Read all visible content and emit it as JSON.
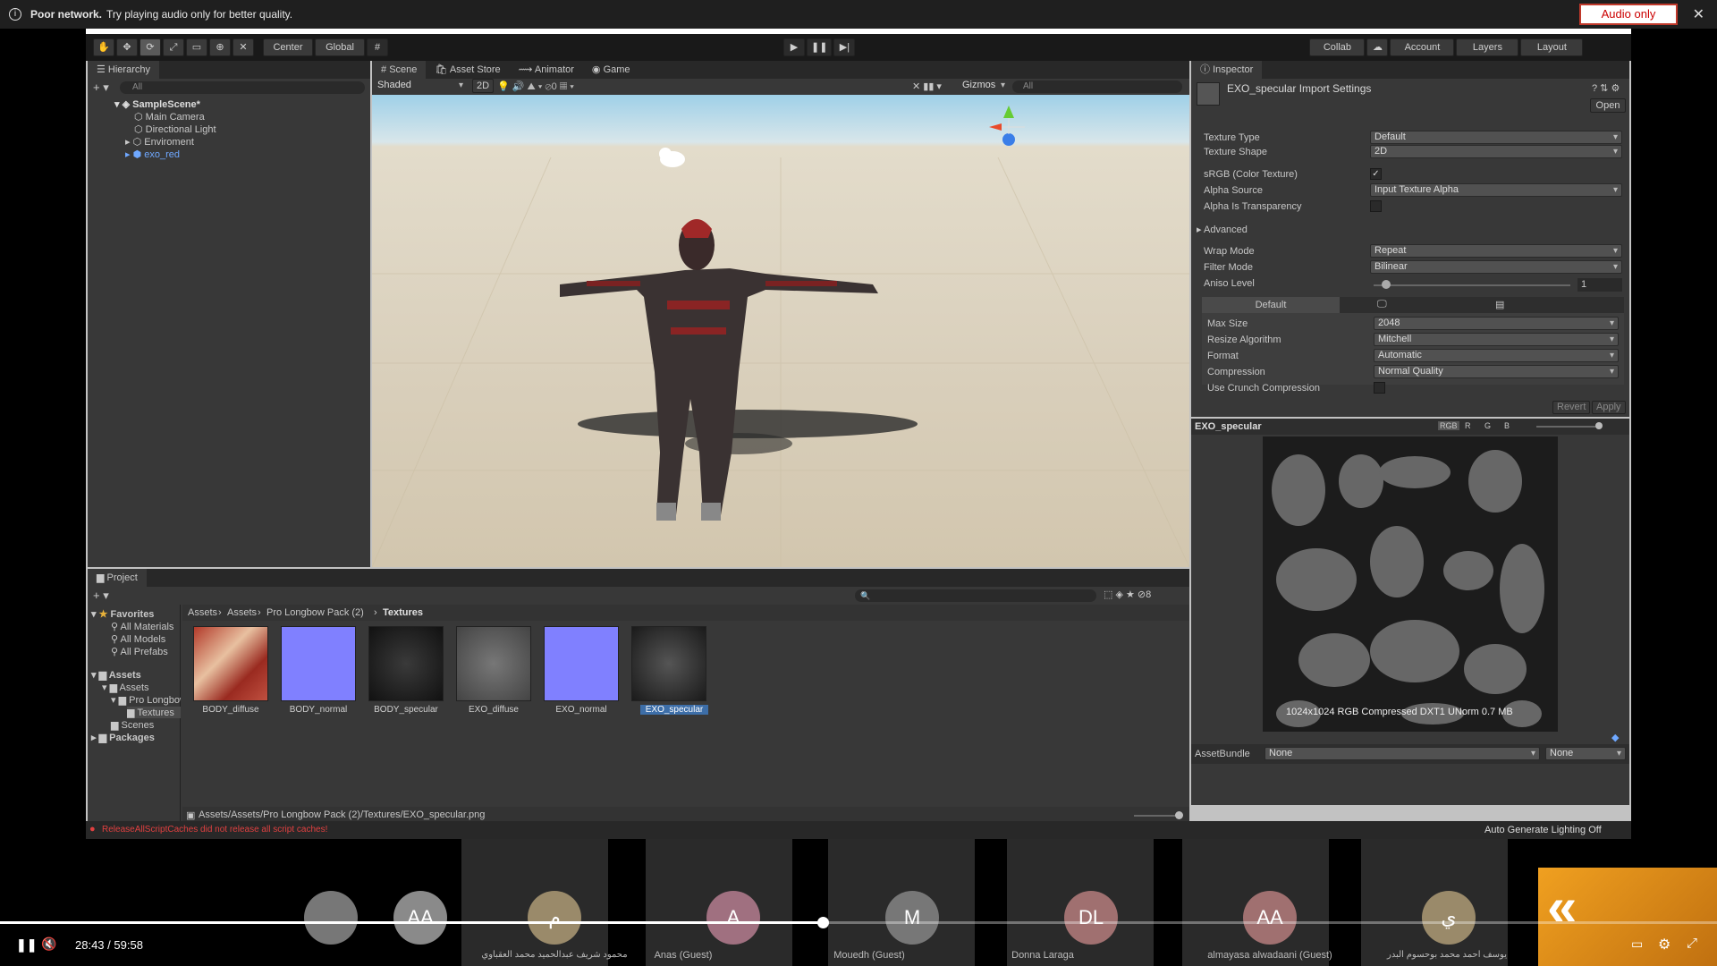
{
  "banner": {
    "title": "Poor network.",
    "text": "Try playing audio only for better quality.",
    "button": "Audio only",
    "close": "✕"
  },
  "toolbar": {
    "center": "Center",
    "global": "Global",
    "collab": "Collab",
    "account": "Account",
    "layers": "Layers",
    "layout": "Layout"
  },
  "hierarchy": {
    "tab": "Hierarchy",
    "search": "All",
    "scene": "SampleScene*",
    "items": [
      "Main Camera",
      "Directional Light",
      "Enviroment",
      "exo_red"
    ]
  },
  "scene": {
    "tabs": [
      "Scene",
      "Asset Store",
      "Animator",
      "Game"
    ],
    "shading": "Shaded",
    "mode2d": "2D",
    "gizmos": "Gizmos",
    "search": "All",
    "count": "0"
  },
  "inspector": {
    "tab": "Inspector",
    "title": "EXO_specular Import Settings",
    "open": "Open",
    "fields": [
      {
        "label": "Texture Type",
        "value": "Default"
      },
      {
        "label": "Texture Shape",
        "value": "2D"
      }
    ],
    "srgb": "sRGB (Color Texture)",
    "alpha_source_label": "Alpha Source",
    "alpha_source": "Input Texture Alpha",
    "alpha_transparency": "Alpha Is Transparency",
    "advanced": "Advanced",
    "wrap_label": "Wrap Mode",
    "wrap": "Repeat",
    "filter_label": "Filter Mode",
    "filter": "Bilinear",
    "aniso_label": "Aniso Level",
    "aniso": "1",
    "platform_default": "Default",
    "platform": [
      {
        "label": "Max Size",
        "value": "2048"
      },
      {
        "label": "Resize Algorithm",
        "value": "Mitchell"
      },
      {
        "label": "Format",
        "value": "Automatic"
      },
      {
        "label": "Compression",
        "value": "Normal Quality"
      }
    ],
    "crunch": "Use Crunch Compression",
    "revert": "Revert",
    "apply": "Apply"
  },
  "preview": {
    "title": "EXO_specular",
    "channels": [
      "RGB",
      "R",
      "G",
      "B"
    ],
    "info": "1024x1024  RGB Compressed DXT1 UNorm   0.7 MB",
    "assetbundle_label": "AssetBundle",
    "bundle": "None",
    "variant": "None"
  },
  "project": {
    "tab": "Project",
    "favorites": "Favorites",
    "fav_items": [
      "All Materials",
      "All Models",
      "All Prefabs"
    ],
    "assets_root": "Assets",
    "tree": [
      "Assets",
      "Pro Longbow Pack (2)",
      "Textures",
      "Scenes"
    ],
    "packages": "Packages",
    "breadcrumb": [
      "Assets",
      "Assets",
      "Pro Longbow Pack (2)",
      "Textures"
    ],
    "thumbs": [
      "BODY_diffuse",
      "BODY_normal",
      "BODY_specular",
      "EXO_diffuse",
      "EXO_normal",
      "EXO_specular"
    ],
    "path": "Assets/Assets/Pro Longbow Pack (2)/Textures/EXO_specular.png",
    "count": "8"
  },
  "console": {
    "error": "ReleaseAllScriptCaches did not release all script caches!",
    "lighting": "Auto Generate Lighting Off"
  },
  "video": {
    "time": "28:43",
    "sep": "/",
    "duration": "59:58",
    "progress": 0.479
  },
  "participants": [
    {
      "initials": "",
      "name": ""
    },
    {
      "initials": "AA",
      "name": ""
    },
    {
      "initials": "م",
      "name": "محمود شريف عبدالحميد محمد العقباوي"
    },
    {
      "initials": "A",
      "name": "Anas (Guest)"
    },
    {
      "initials": "M",
      "name": "Mouedh (Guest)"
    },
    {
      "initials": "DL",
      "name": "Donna Laraga"
    },
    {
      "initials": "AA",
      "name": "almayasa alwadaani (Guest)"
    },
    {
      "initials": "ي",
      "name": "يوسف احمد محمد بوحسوم البدر"
    }
  ],
  "colors": {
    "unity_bg": "#383838",
    "accent": "#3d6ea8",
    "error": "#e04040"
  }
}
